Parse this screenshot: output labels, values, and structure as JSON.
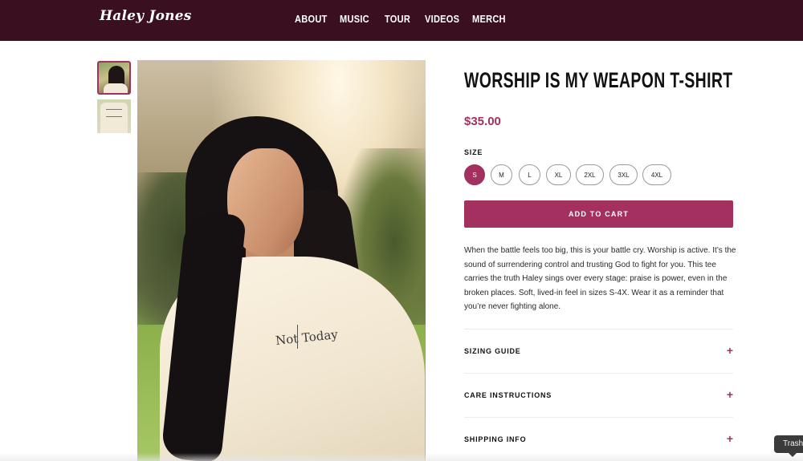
{
  "header": {
    "logo": "Haley Jones",
    "nav": [
      "ABOUT",
      "MUSIC",
      "TOUR",
      "VIDEOS",
      "MERCH"
    ]
  },
  "product": {
    "title": "WORSHIP IS MY WEAPON T-SHIRT",
    "price": "$35.00",
    "size_label": "SIZE",
    "sizes": [
      "S",
      "M",
      "L",
      "XL",
      "2XL",
      "3XL",
      "4XL"
    ],
    "selected_size": "S",
    "add_to_cart": "ADD TO CART",
    "description": "When the battle feels too big, this is your battle cry. Worship is active. It’s the sound of surrendering control and trusting God to fight for you. This tee carries the truth Haley sings over every stage: praise is power, even in the broken places. Soft, lived-in feel in sizes S-4X. Wear it as a reminder that you’re never fighting alone.",
    "shirt_print": "Not Today"
  },
  "accordion": [
    {
      "label": "SIZING GUIDE",
      "icon": "+"
    },
    {
      "label": "CARE INSTRUCTIONS",
      "icon": "+"
    },
    {
      "label": "SHIPPING INFO",
      "icon": "+"
    }
  ],
  "tooltip": "Trash",
  "colors": {
    "header_bg": "#3a1020",
    "accent": "#a3305f"
  },
  "icons": {
    "accordion_toggle": "plus-icon"
  }
}
